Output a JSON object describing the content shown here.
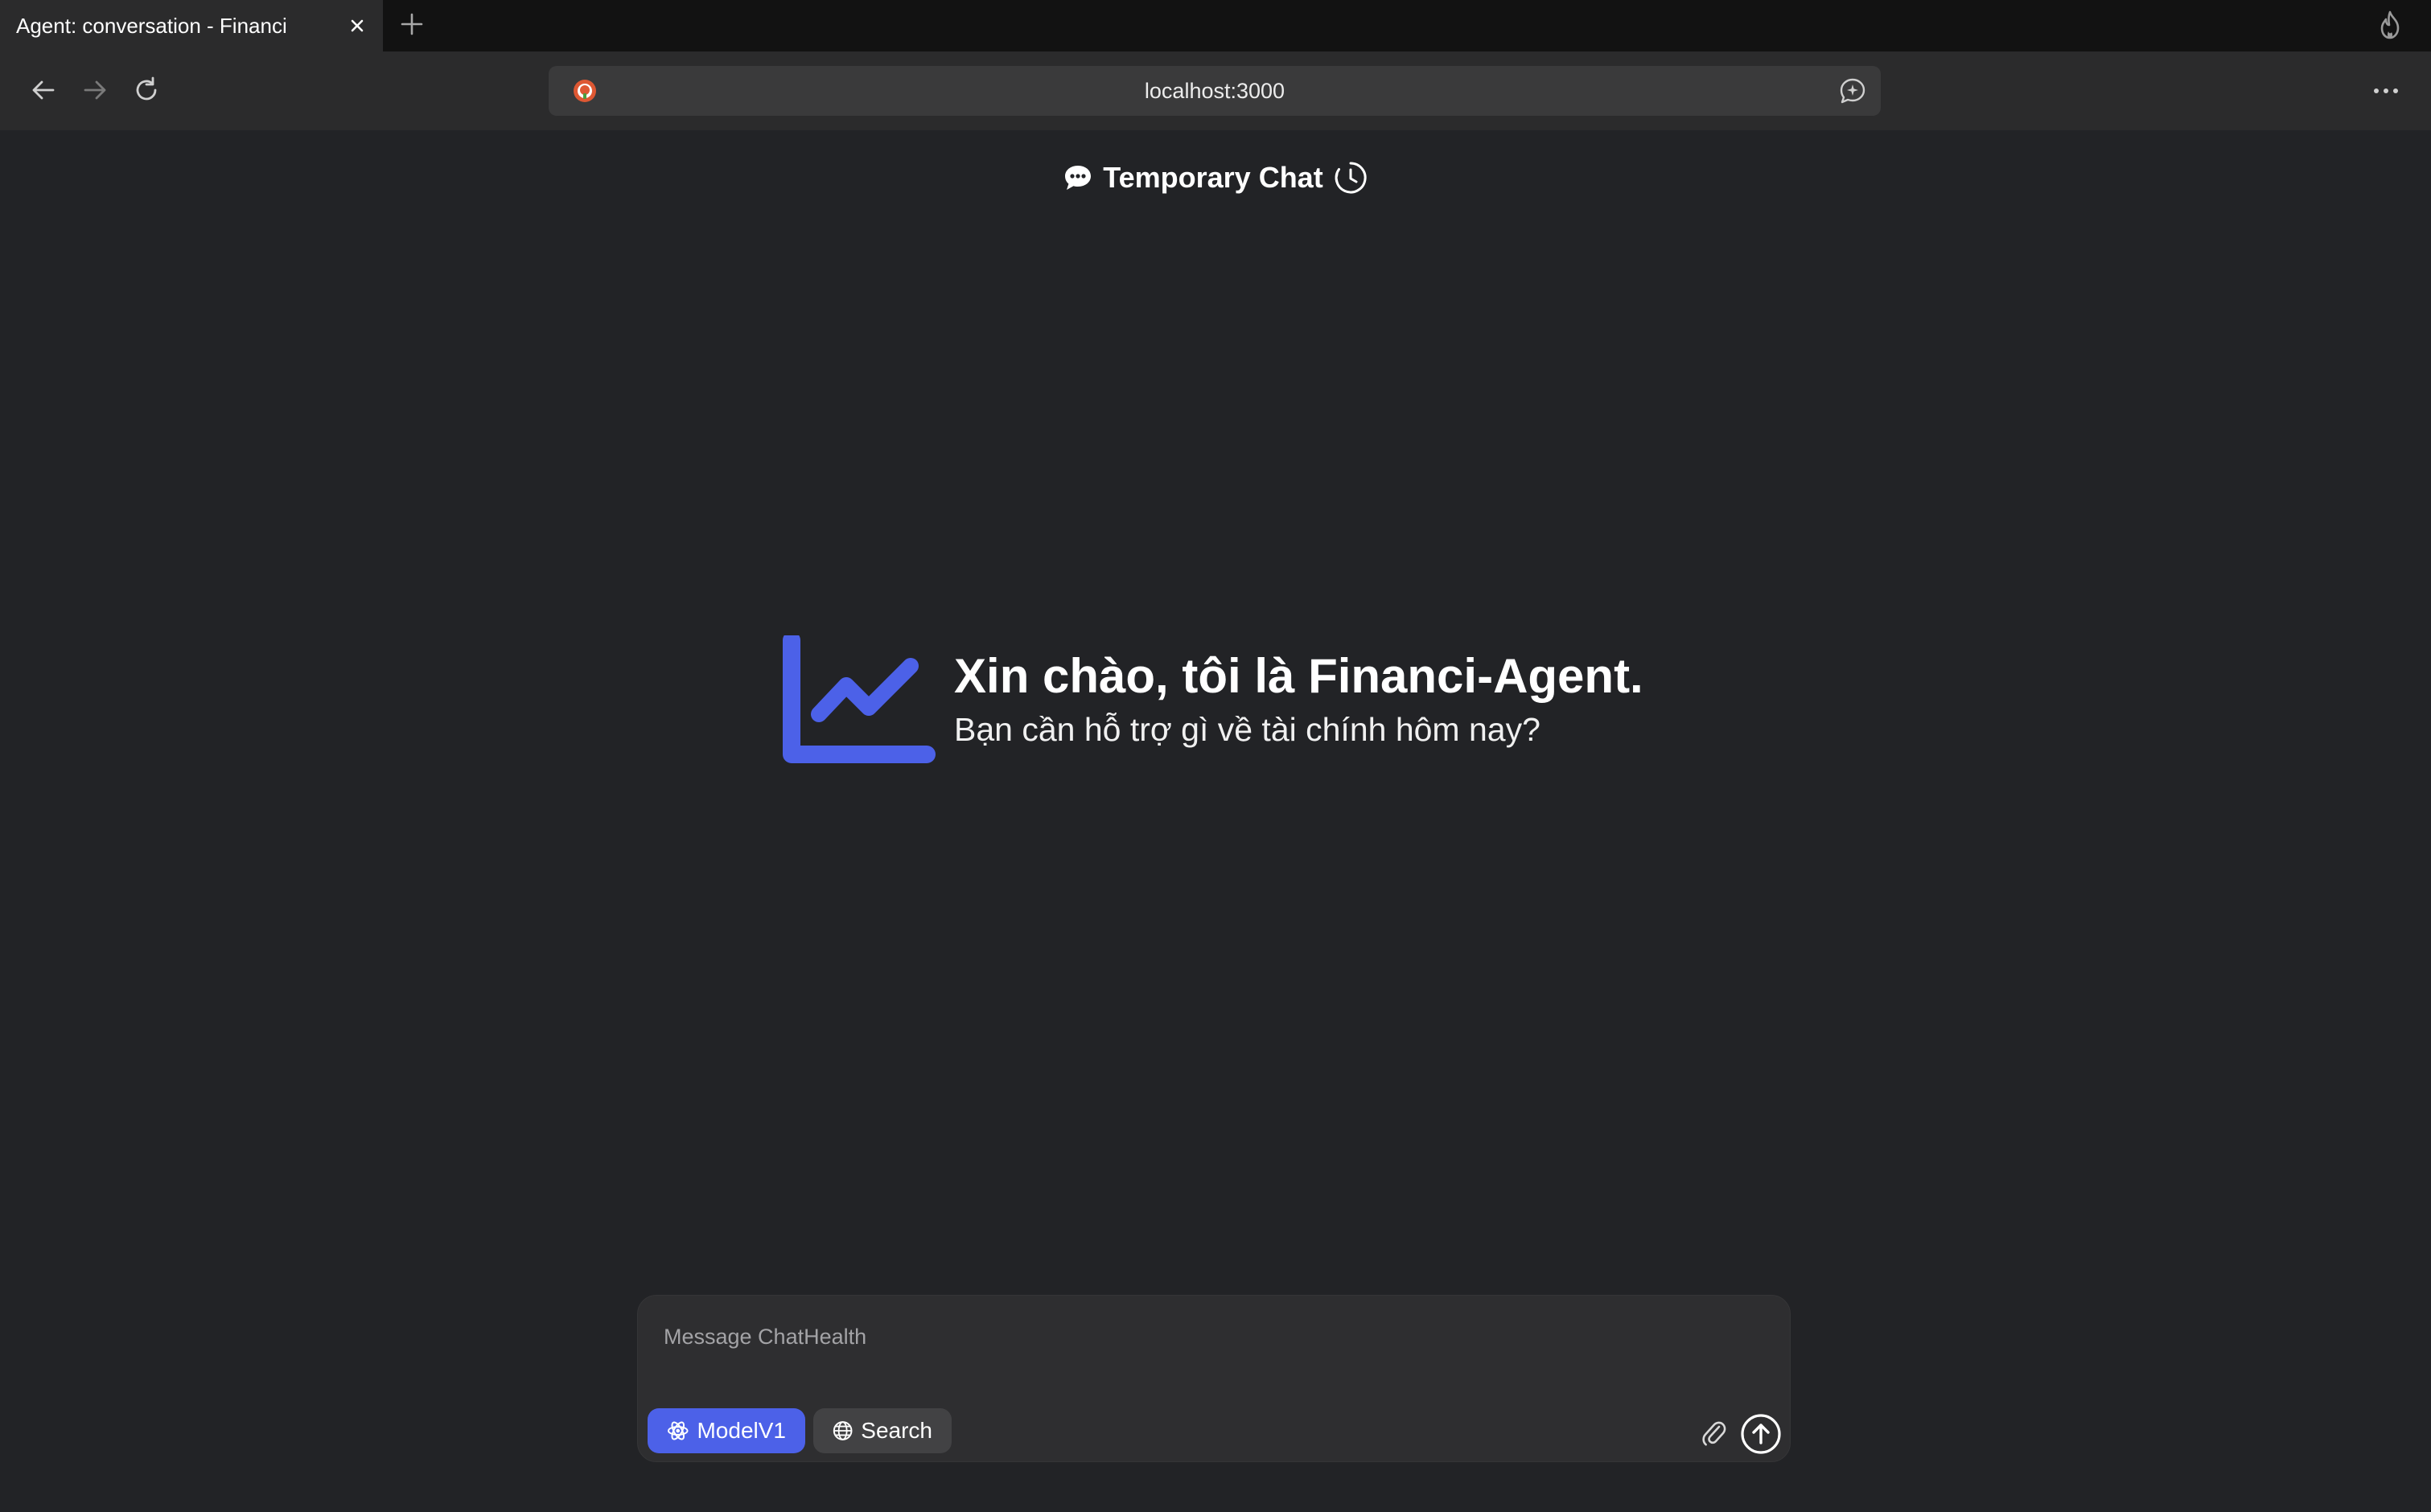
{
  "browser": {
    "tab_title": "Agent: conversation - Financi",
    "url": "localhost:3000"
  },
  "header": {
    "title": "Temporary Chat"
  },
  "hero": {
    "title": "Xin chào, tôi là Financi-Agent.",
    "subtitle": "Bạn cần hỗ trợ gì về tài chính hôm nay?"
  },
  "composer": {
    "placeholder": "Message ChatHealth",
    "model_label": "ModelV1",
    "search_label": "Search"
  },
  "colors": {
    "background": "#222326",
    "accent": "#4c61e8",
    "tabstrip": "#121212",
    "toolbar": "#2b2b2c"
  },
  "icons": [
    "close-icon",
    "plus-icon",
    "flame-icon",
    "back-arrow-icon",
    "forward-arrow-icon",
    "reload-icon",
    "duckduckgo-icon",
    "ai-chat-icon",
    "more-dots-icon",
    "speech-bubble-icon",
    "clock-icon",
    "line-chart-icon",
    "atom-icon",
    "globe-icon",
    "paperclip-icon",
    "send-arrow-icon"
  ]
}
